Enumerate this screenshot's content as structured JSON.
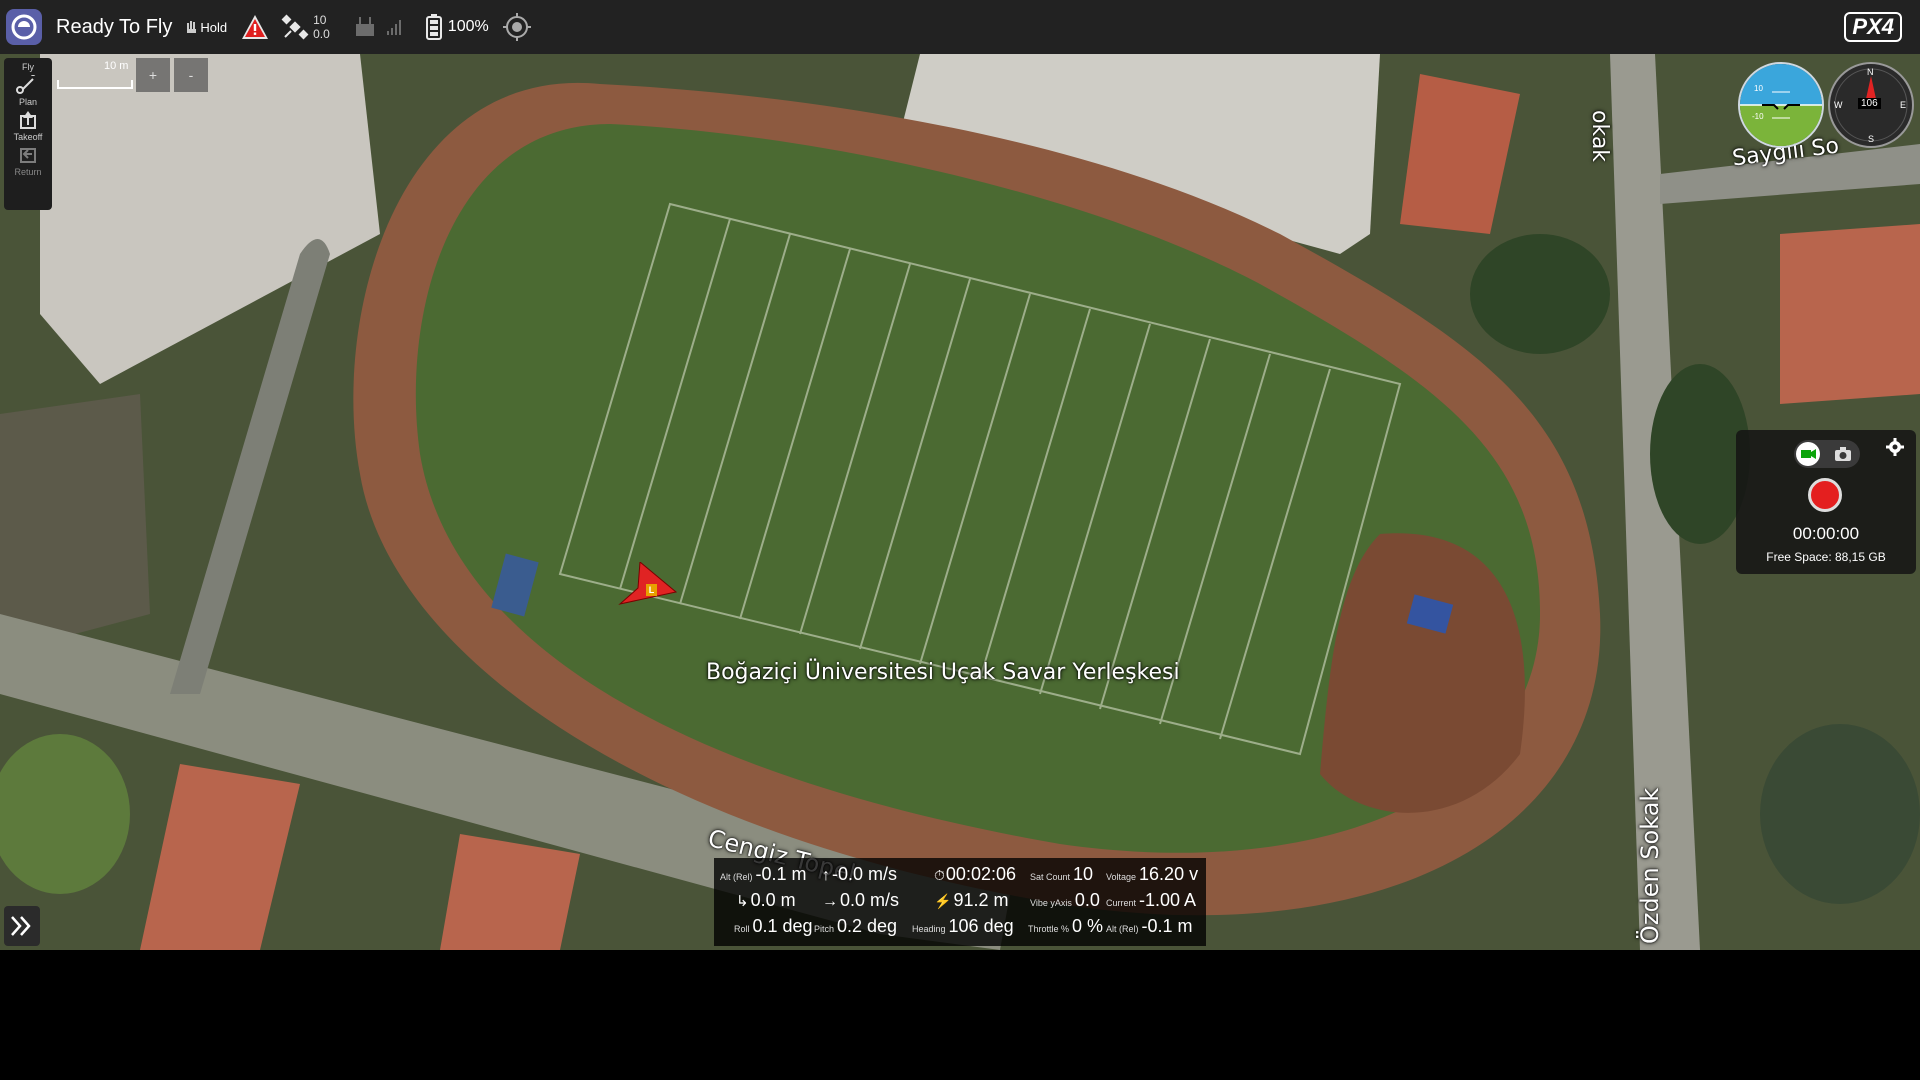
{
  "toolbar": {
    "status": "Ready To Fly",
    "flight_mode": "Hold",
    "satellite_count": "10",
    "hdop": "0.0",
    "battery_percent": "100%",
    "brand": "PX4"
  },
  "toolstrip": {
    "fly_label": "Fly",
    "plan_label": "Plan",
    "takeoff_label": "Takeoff",
    "return_label": "Return"
  },
  "map": {
    "scale_label": "10 m",
    "zoom_in": "+",
    "zoom_out": "-",
    "place_label": "Boğaziçi Üniversitesi Uçak Savar Yerleşkesi",
    "street_1": "Cengiz Topel",
    "street_2": "Özden Sokak",
    "street_3": "Saygılı So",
    "street_4": "okak",
    "vehicle_marker": "L"
  },
  "camera": {
    "timer": "00:00:00",
    "free_space": "Free Space: 88,15 GB"
  },
  "instruments": {
    "attitude_upper": "10",
    "attitude_lower": "-10",
    "compass_heading": "106",
    "compass_n": "N",
    "compass_e": "E",
    "compass_s": "S",
    "compass_w": "W"
  },
  "telemetry": {
    "alt_rel_label": "Alt (Rel)",
    "alt_rel": "-0.1 m",
    "climb_rate": "-0.0 m/s",
    "flight_time": "00:02:06",
    "sat_count_label": "Sat Count",
    "sat_count": "10",
    "voltage_label": "Voltage",
    "voltage": "16.20 v",
    "distance_home": "0.0 m",
    "ground_speed": "0.0 m/s",
    "distance_value": "91.2 m",
    "vibe_label": "Vibe yAxis",
    "vibe": "0.0",
    "current_label": "Current",
    "current": "-1.00 A",
    "roll_label": "Roll",
    "roll": "0.1 deg",
    "pitch_label": "Pitch",
    "pitch": "0.2 deg",
    "heading_label": "Heading",
    "heading": "106 deg",
    "throttle_label": "Throttle %",
    "throttle": "0 %",
    "alt_rel2_label": "Alt (Rel)",
    "alt_rel2": "-0.1 m"
  }
}
